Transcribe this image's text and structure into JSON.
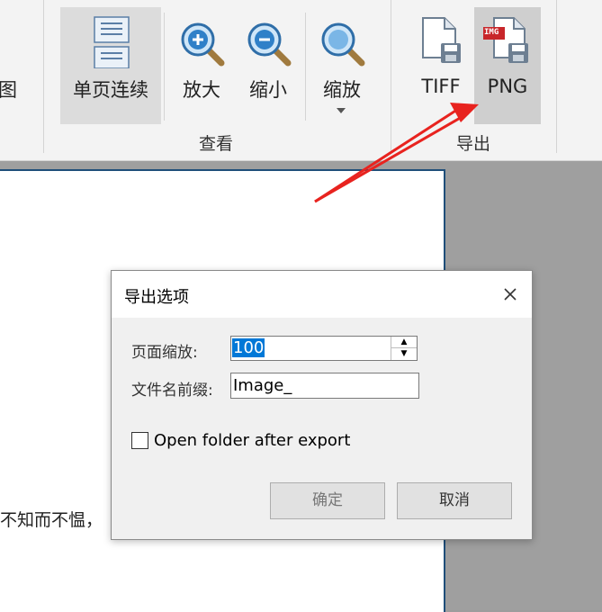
{
  "ribbon": {
    "partial_label": "图",
    "view_group": {
      "label": "查看",
      "buttons": {
        "single_page_continuous": "单页连续",
        "zoom_in": "放大",
        "zoom_out": "缩小",
        "zoom": "缩放"
      }
    },
    "export_group": {
      "label": "导出",
      "buttons": {
        "tiff": "TIFF",
        "png": "PNG"
      },
      "png_icon_badge": "IMG"
    }
  },
  "document": {
    "visible_text": "不知而不愠，"
  },
  "dialog": {
    "title": "导出选项",
    "page_zoom_label": "页面缩放:",
    "page_zoom_value": "100",
    "filename_prefix_label": "文件名前缀:",
    "filename_prefix_value": "Image_",
    "open_folder_label": "Open folder after export",
    "open_folder_checked": false,
    "ok_label": "确定",
    "cancel_label": "取消"
  },
  "colors": {
    "annotation_arrow": "#e8231f",
    "selection": "#0078d7",
    "page_border": "#1f4e79"
  },
  "icons": [
    "page-icon",
    "zoom-in-icon",
    "zoom-out-icon",
    "zoom-icon",
    "tiff-file-icon",
    "png-file-icon",
    "close-icon",
    "spin-up-icon",
    "spin-down-icon",
    "dropdown-arrow-icon"
  ]
}
